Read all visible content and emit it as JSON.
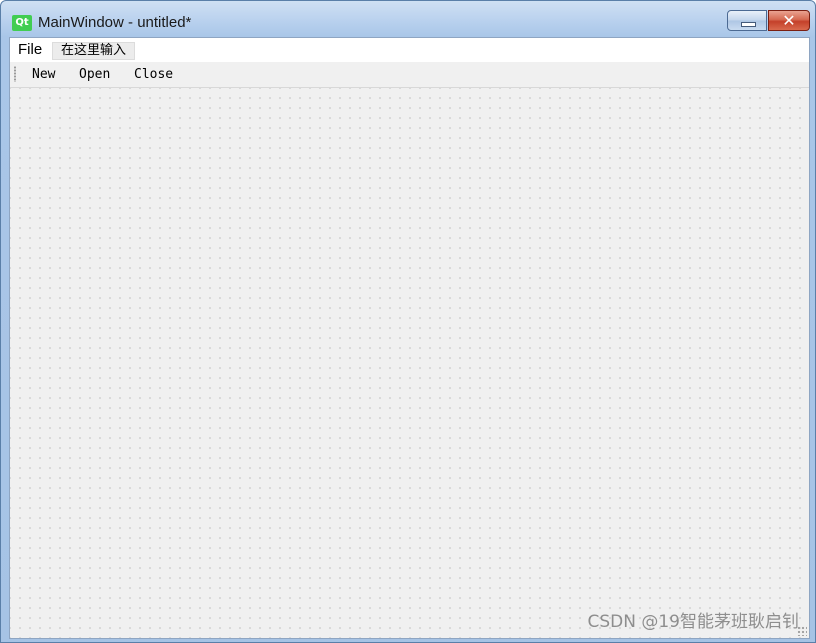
{
  "window": {
    "app_icon_text": "Qt",
    "title": "MainWindow - untitled*",
    "close_glyph": "✕"
  },
  "menubar": {
    "file_label": "File",
    "input_placeholder_label": "在这里输入"
  },
  "toolbar": {
    "new_label": "New",
    "open_label": "Open",
    "close_label": "Close"
  },
  "watermark": {
    "text": "CSDN @19智能茅班耿启钊"
  },
  "colors": {
    "qt_green": "#41cd52",
    "canvas_bg": "#f0f0f0",
    "title_bar": "#b9d1ee",
    "close_button": "#c4402a"
  },
  "icons": {
    "app": "qt-logo-icon",
    "minimize": "minimize-icon",
    "close": "close-icon"
  }
}
